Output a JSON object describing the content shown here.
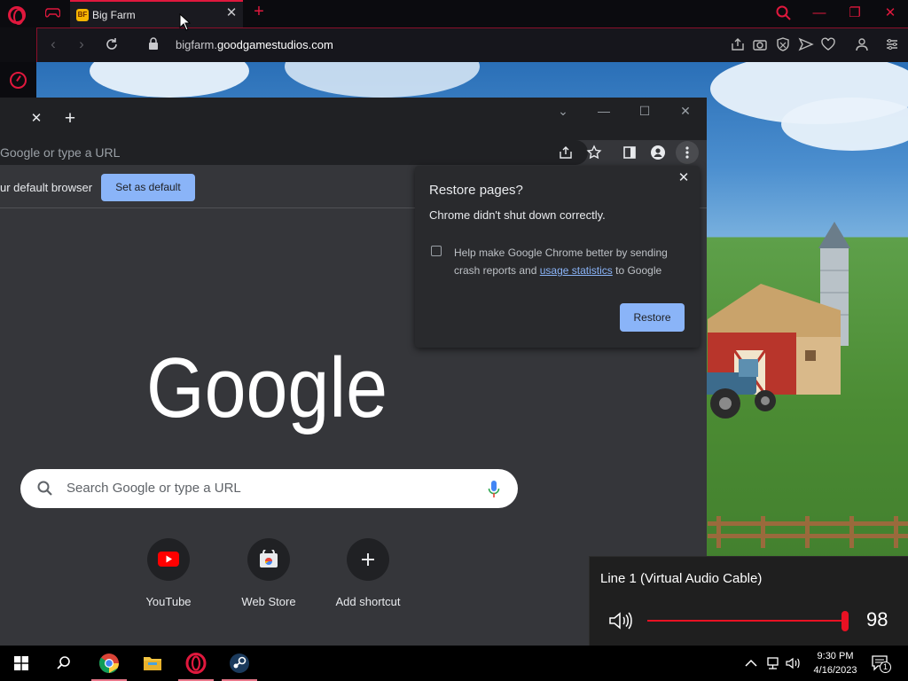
{
  "opera": {
    "tab_title": "Big Farm",
    "tab_favicon_text": "BF",
    "url_prefix": "bigfarm.",
    "url_domain": "goodgamestudios.com"
  },
  "chrome": {
    "omnibox_text": "Google or type a URL",
    "infobar_text": "ur default browser",
    "set_default_label": "Set as default",
    "search_placeholder": "Search Google or type a URL",
    "shortcuts": [
      {
        "label": "YouTube",
        "icon": "youtube-icon"
      },
      {
        "label": "Web Store",
        "icon": "web-store-icon"
      },
      {
        "label": "Add shortcut",
        "icon": "plus-icon"
      }
    ],
    "restore": {
      "title": "Restore pages?",
      "subtitle": "Chrome didn't shut down correctly.",
      "checkbox_text_before": "Help make Google Chrome better by sending crash reports and",
      "checkbox_link": "usage statistics",
      "checkbox_text_after": "to Google",
      "button": "Restore"
    }
  },
  "volume": {
    "device": "Line 1 (Virtual Audio Cable)",
    "value": "98",
    "level_percent": 98,
    "accent": "#e81123"
  },
  "taskbar": {
    "time": "9:30 PM",
    "date": "4/16/2023",
    "notification_count": "1",
    "apps": [
      "windows-start-icon",
      "search-icon",
      "chrome-icon",
      "file-explorer-icon",
      "opera-icon",
      "steam-icon"
    ]
  },
  "colors": {
    "opera_accent": "#e0183d",
    "chrome_blue": "#8ab4f8"
  }
}
